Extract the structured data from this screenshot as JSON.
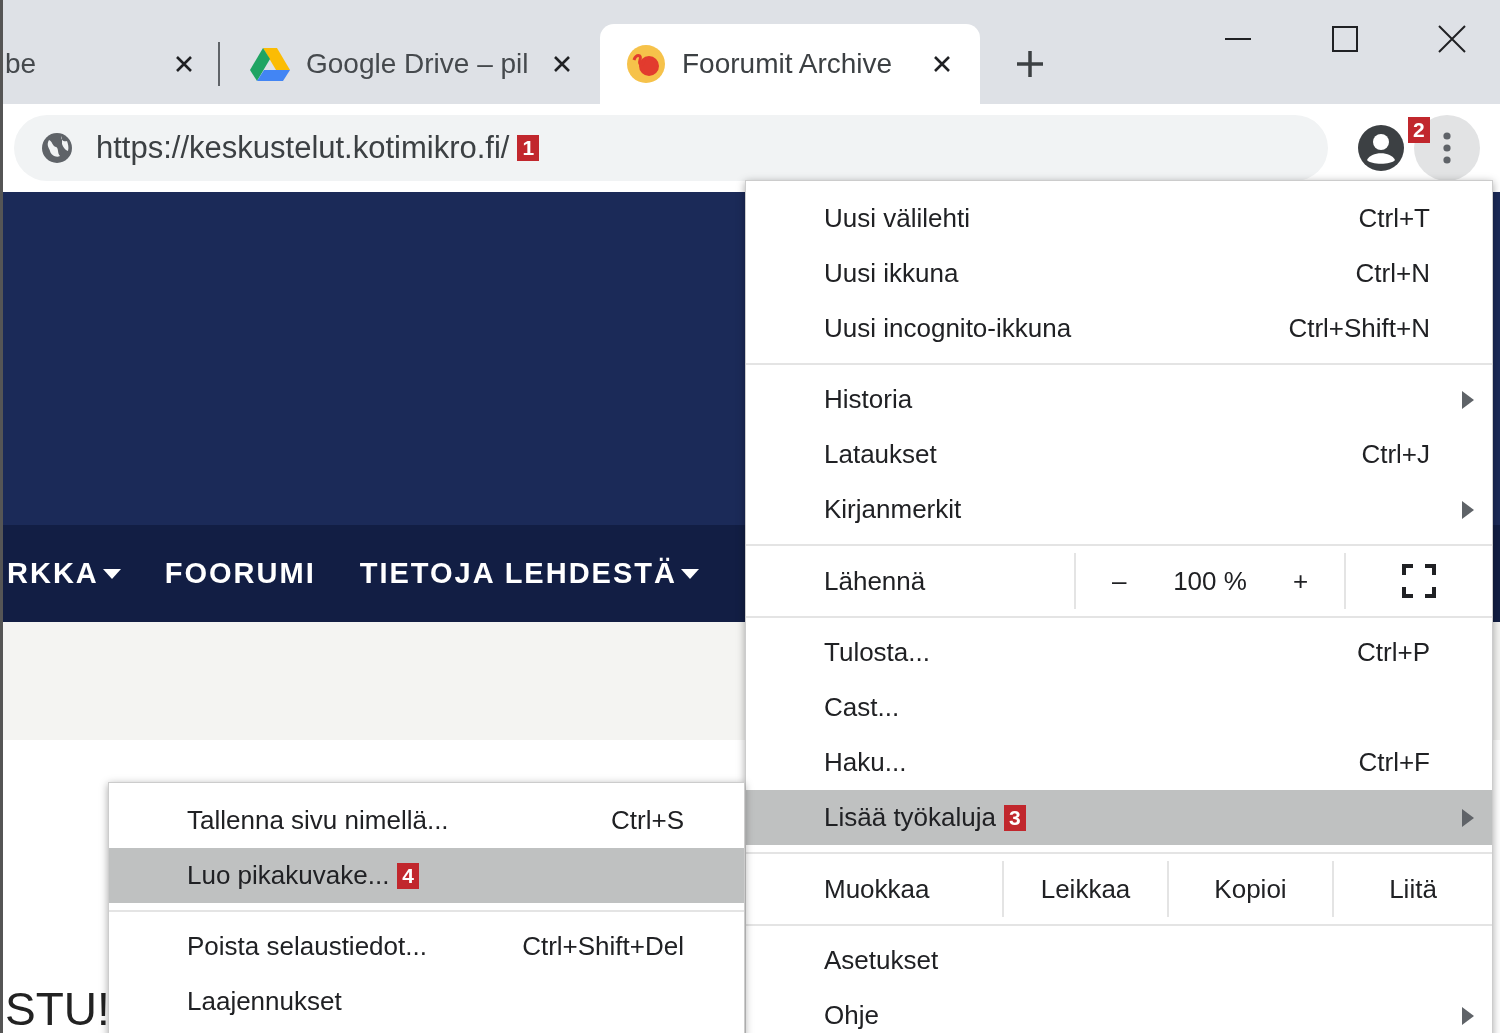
{
  "tabs": [
    {
      "title": "be",
      "selected": false,
      "kind": "plain"
    },
    {
      "title": "Google Drive – pil",
      "selected": false,
      "kind": "drive"
    },
    {
      "title": "Foorumit Archive",
      "selected": true,
      "kind": "site"
    }
  ],
  "address_bar": {
    "url": "https://keskustelut.kotimikro.fi/",
    "callout": "1"
  },
  "toolbar": {
    "menu_callout": "2"
  },
  "site_nav": [
    {
      "label": "RKKA",
      "has_dropdown": true
    },
    {
      "label": "FOORUMI",
      "has_dropdown": false
    },
    {
      "label": "TIETOJA LEHDESTÄ",
      "has_dropdown": true
    }
  ],
  "page_text": "STU!",
  "main_menu": [
    {
      "kind": "item",
      "label": "Uusi välilehti",
      "shortcut": "Ctrl+T",
      "submenu": false,
      "selected": false
    },
    {
      "kind": "item",
      "label": "Uusi ikkuna",
      "shortcut": "Ctrl+N",
      "submenu": false,
      "selected": false
    },
    {
      "kind": "item",
      "label": "Uusi incognito-ikkuna",
      "shortcut": "Ctrl+Shift+N",
      "submenu": false,
      "selected": false
    },
    {
      "kind": "separator"
    },
    {
      "kind": "item",
      "label": "Historia",
      "submenu": true,
      "selected": false
    },
    {
      "kind": "item",
      "label": "Lataukset",
      "shortcut": "Ctrl+J",
      "submenu": false,
      "selected": false
    },
    {
      "kind": "item",
      "label": "Kirjanmerkit",
      "submenu": true,
      "selected": false
    },
    {
      "kind": "separator"
    },
    {
      "kind": "zoom",
      "label": "Lähennä",
      "minus": "–",
      "level_text": "100 %",
      "plus": "+"
    },
    {
      "kind": "separator"
    },
    {
      "kind": "item",
      "label": "Tulosta...",
      "shortcut": "Ctrl+P",
      "submenu": false,
      "selected": false
    },
    {
      "kind": "item",
      "label": "Cast...",
      "submenu": false,
      "selected": false
    },
    {
      "kind": "item",
      "label": "Haku...",
      "shortcut": "Ctrl+F",
      "submenu": false,
      "selected": false
    },
    {
      "kind": "item",
      "label": "Lisää työkaluja",
      "callout": "3",
      "submenu": true,
      "selected": true
    },
    {
      "kind": "separator"
    },
    {
      "kind": "edit",
      "label": "Muokkaa",
      "actions": [
        "Leikkaa",
        "Kopioi",
        "Liitä"
      ]
    },
    {
      "kind": "separator"
    },
    {
      "kind": "item",
      "label": "Asetukset",
      "submenu": false,
      "selected": false
    },
    {
      "kind": "item",
      "label": "Ohje",
      "submenu": true,
      "selected": false
    }
  ],
  "sub_menu": [
    {
      "kind": "item",
      "label": "Tallenna sivu nimellä...",
      "shortcut": "Ctrl+S",
      "submenu": false,
      "selected": false
    },
    {
      "kind": "item",
      "label": "Luo pikakuvake...",
      "callout": "4",
      "submenu": false,
      "selected": true
    },
    {
      "kind": "separator"
    },
    {
      "kind": "item",
      "label": "Poista selaustiedot...",
      "shortcut": "Ctrl+Shift+Del",
      "submenu": false,
      "selected": false
    },
    {
      "kind": "item",
      "label": "Laajennukset",
      "submenu": false,
      "selected": false
    }
  ]
}
